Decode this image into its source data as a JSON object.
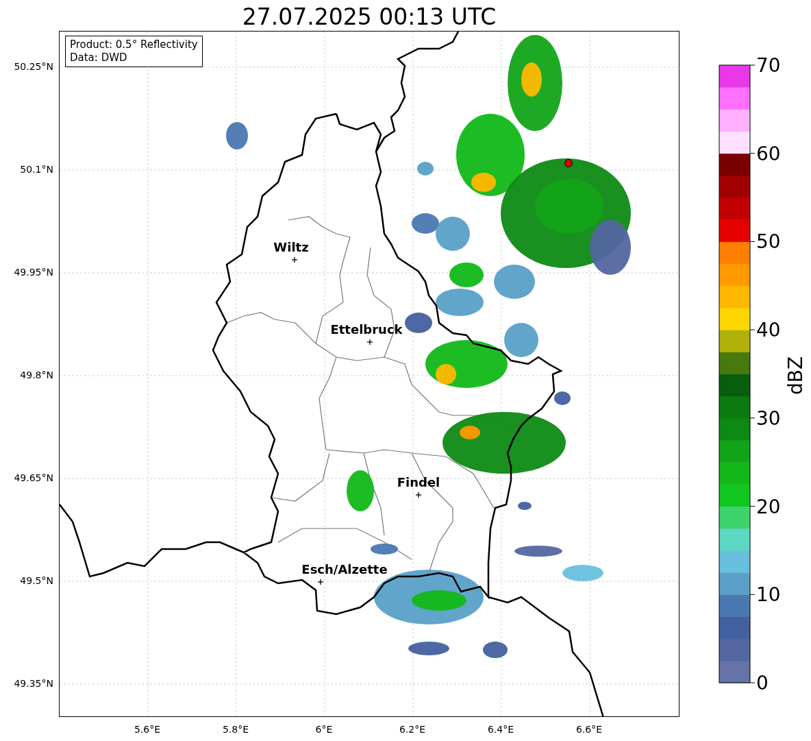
{
  "title": "27.07.2025 00:13 UTC",
  "info_box": [
    "Product: 0.5° Reflectivity",
    "Data: DWD"
  ],
  "lat_ticks": [
    "50.25°N",
    "50.1°N",
    "49.95°N",
    "49.8°N",
    "49.65°N",
    "49.5°N",
    "49.35°N"
  ],
  "lon_ticks": [
    "5.6°E",
    "5.8°E",
    "6°E",
    "6.2°E",
    "6.4°E",
    "6.6°E"
  ],
  "cities": [
    {
      "name": "Wiltz"
    },
    {
      "name": "Ettelbruck"
    },
    {
      "name": "Findel"
    },
    {
      "name": "Esch/Alzette"
    }
  ],
  "colorbar": {
    "label": "dBZ",
    "ticks": [
      "70",
      "60",
      "50",
      "40",
      "30",
      "20",
      "10",
      "0"
    ],
    "bins": [
      {
        "color": "#6573a8"
      },
      {
        "color": "#5366a0"
      },
      {
        "color": "#4360a0"
      },
      {
        "color": "#4a78b0"
      },
      {
        "color": "#5aa0c8"
      },
      {
        "color": "#68c0dc"
      },
      {
        "color": "#5ed8c4"
      },
      {
        "color": "#3ed46c"
      },
      {
        "color": "#10c820"
      },
      {
        "color": "#12b818"
      },
      {
        "color": "#12a418"
      },
      {
        "color": "#0d8a14"
      },
      {
        "color": "#0b7a10"
      },
      {
        "color": "#075e0c"
      },
      {
        "color": "#467a0c"
      },
      {
        "color": "#b0b008"
      },
      {
        "color": "#ffd700"
      },
      {
        "color": "#ffb800"
      },
      {
        "color": "#ff9a00"
      },
      {
        "color": "#ff7e00"
      },
      {
        "color": "#e60000"
      },
      {
        "color": "#c20000"
      },
      {
        "color": "#a00000"
      },
      {
        "color": "#7a0000"
      },
      {
        "color": "#ffe0ff"
      },
      {
        "color": "#ffb0ff"
      },
      {
        "color": "#ff70ff"
      },
      {
        "color": "#e838e8"
      }
    ]
  }
}
